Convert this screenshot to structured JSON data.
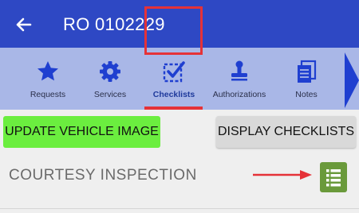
{
  "header": {
    "title": "RO 0102229",
    "back_icon": "arrow-left-icon"
  },
  "tabs": [
    {
      "label": "Requests",
      "icon": "star-icon"
    },
    {
      "label": "Services",
      "icon": "gear-icon"
    },
    {
      "label": "Checklists",
      "icon": "checkbox-icon",
      "active": true
    },
    {
      "label": "Authorizations",
      "icon": "stamp-icon"
    },
    {
      "label": "Notes",
      "icon": "notes-icon"
    }
  ],
  "actions": {
    "update_vehicle_image": "UPDATE VEHICLE IMAGE",
    "display_checklists": "DISPLAY CHECKLISTS"
  },
  "section": {
    "title": "COURTESY INSPECTION"
  },
  "colors": {
    "appbar": "#2e48c4",
    "tabbar": "#a9b7e7",
    "icon": "#1f3fd0",
    "highlight": "#e53238",
    "update_button": "#6bee3f",
    "checklist_button": "#6a9a3b"
  }
}
